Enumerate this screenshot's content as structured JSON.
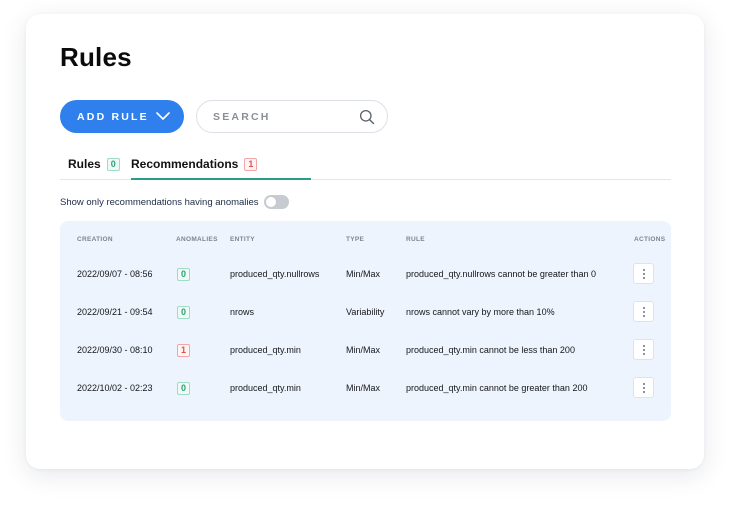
{
  "page": {
    "title": "Rules"
  },
  "toolbar": {
    "add_label": "ADD RULE",
    "search_placeholder": "SEARCH"
  },
  "tabs": [
    {
      "label": "Rules",
      "count": "0",
      "badge_color": "green",
      "active": false
    },
    {
      "label": "Recommendations",
      "count": "1",
      "badge_color": "red",
      "active": true
    }
  ],
  "filter": {
    "label": "Show only recommendations having anomalies",
    "enabled": false
  },
  "table": {
    "headers": {
      "creation": "CREATION",
      "anomalies": "ANOMALIES",
      "entity": "ENTITY",
      "type": "TYPE",
      "rule": "RULE",
      "actions": "ACTIONS"
    },
    "rows": [
      {
        "creation": "2022/09/07 - 08:56",
        "anomalies": "0",
        "anomaly_color": "green",
        "entity": "produced_qty.nullrows",
        "type": "Min/Max",
        "rule": "produced_qty.nullrows cannot be greater than 0"
      },
      {
        "creation": "2022/09/21 - 09:54",
        "anomalies": "0",
        "anomaly_color": "green",
        "entity": "nrows",
        "type": "Variability",
        "rule": "nrows cannot vary by more than 10%"
      },
      {
        "creation": "2022/09/30 - 08:10",
        "anomalies": "1",
        "anomaly_color": "red",
        "entity": "produced_qty.min",
        "type": "Min/Max",
        "rule": "produced_qty.min cannot be less than 200"
      },
      {
        "creation": "2022/10/02 - 02:23",
        "anomalies": "0",
        "anomaly_color": "green",
        "entity": "produced_qty.min",
        "type": "Min/Max",
        "rule": "produced_qty.min cannot be greater than 200"
      }
    ]
  },
  "colors": {
    "accent": "#2f80ed",
    "tab_underline": "#2b9c8c",
    "badge_green": "#27a37a",
    "badge_red": "#e25252",
    "table_bg": "#eef4fd"
  },
  "icons": {
    "add_dropdown": "chevron-down-icon",
    "search": "search-icon",
    "row_actions": "kebab-menu-icon"
  }
}
